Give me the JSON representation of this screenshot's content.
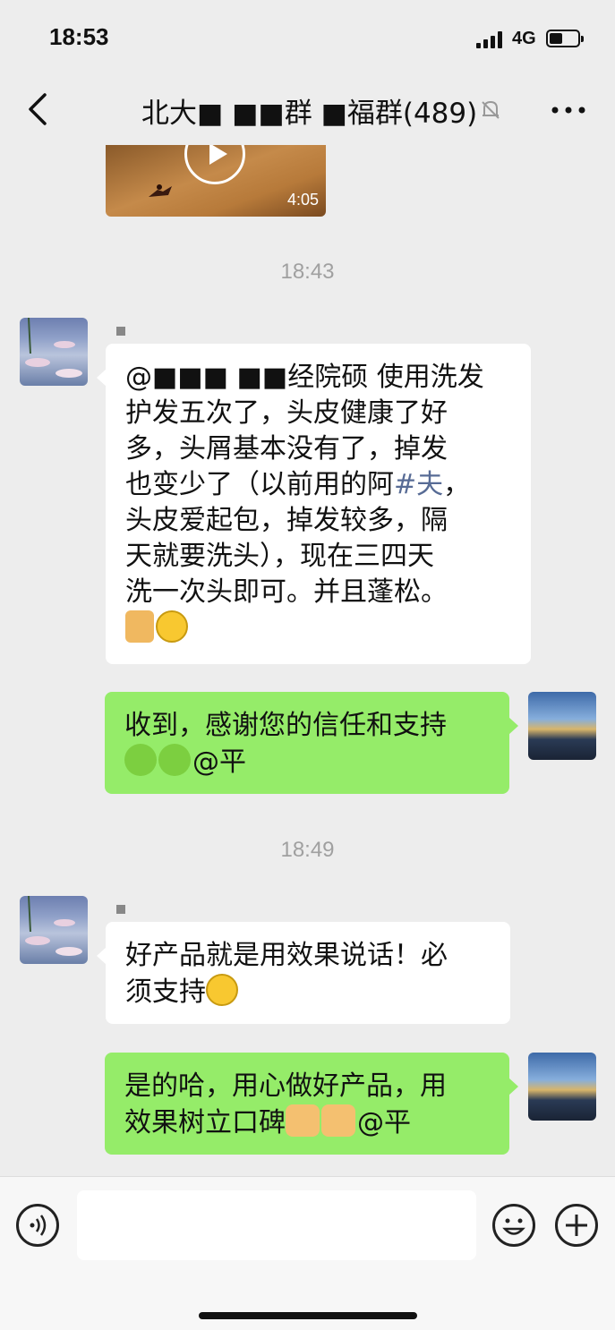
{
  "status_bar": {
    "time": "18:53",
    "network": "4G",
    "battery_level": 0.45
  },
  "nav": {
    "title": "北大■ ■■群 ■福群(489)"
  },
  "video": {
    "duration": "4:05"
  },
  "messages": [
    {
      "type": "timestamp",
      "text": "18:43"
    },
    {
      "type": "incoming",
      "lines": [
        "@■■■ ■■经院硕 使用洗发",
        "护发五次了，头皮健康了好",
        "多，头屑基本没有了，掉发",
        "也变少了（以前用的阿#夫，",
        "头皮爱起包，掉发较多，隔",
        "天就要洗头），现在三四天",
        "洗一次头即可。并且蓬松。"
      ],
      "link_text": "#夫"
    },
    {
      "type": "outgoing",
      "line1": "收到，感谢您的信任和支持",
      "mention": "@平"
    },
    {
      "type": "timestamp",
      "text": "18:49"
    },
    {
      "type": "incoming",
      "line1": "好产品就是用效果说话！必",
      "line2": "须支持"
    },
    {
      "type": "outgoing",
      "line1": "是的哈，用心做好产品，用",
      "line2": "效果树立口碑",
      "mention": "@平"
    }
  ],
  "colors": {
    "bubble_green": "#95ec69",
    "background": "#ededed",
    "link": "#576b95"
  },
  "icons": [
    "back-icon",
    "mute-bell-icon",
    "more-icon",
    "play-icon",
    "voice-icon",
    "emoji-icon",
    "plus-icon"
  ]
}
